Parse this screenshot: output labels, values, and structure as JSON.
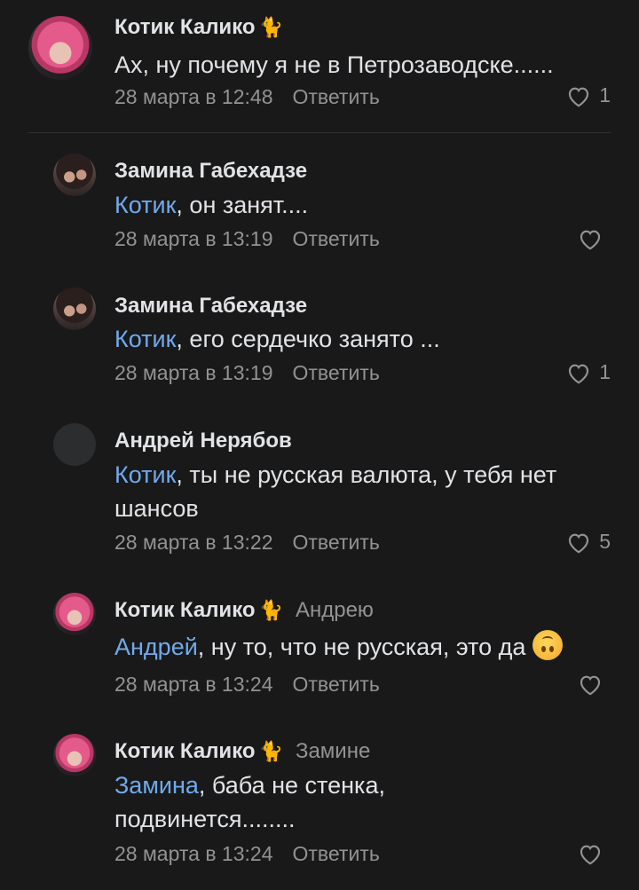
{
  "comments": [
    {
      "author": "Котик Калико",
      "author_emoji": "🐈",
      "reply_to": "",
      "mention": "",
      "text": "Ах, ну почему я не в Петрозаводске......",
      "date": "28 марта в 12:48",
      "reply_label": "Ответить",
      "likes": "1",
      "avatar": "kotik"
    },
    {
      "author": "Замина Габехадзе",
      "author_emoji": "",
      "reply_to": "",
      "mention": "Котик",
      "text": ", он занят....",
      "date": "28 марта в 13:19",
      "reply_label": "Ответить",
      "likes": "",
      "avatar": "zamina"
    },
    {
      "author": "Замина Габехадзе",
      "author_emoji": "",
      "reply_to": "",
      "mention": "Котик",
      "text": ", его сердечко занято ...",
      "date": "28 марта в 13:19",
      "reply_label": "Ответить",
      "likes": "1",
      "avatar": "zamina"
    },
    {
      "author": "Андрей Нерябов",
      "author_emoji": "",
      "reply_to": "",
      "mention": "Котик",
      "text": ", ты не русская валюта, у тебя нет шансов",
      "date": "28 марта в 13:22",
      "reply_label": "Ответить",
      "likes": "5",
      "avatar": "andrey"
    },
    {
      "author": "Котик Калико",
      "author_emoji": "🐈",
      "reply_to": "Андрею",
      "mention": "Андрей",
      "text": ", ну то, что не русская, это да",
      "trailing_emoji": "upside-down-face-icon",
      "date": "28 марта в 13:24",
      "reply_label": "Ответить",
      "likes": "",
      "avatar": "kotik"
    },
    {
      "author": "Котик Калико",
      "author_emoji": "🐈",
      "reply_to": "Замине",
      "mention": "Замина",
      "text": ", баба не стенка, подвинется........",
      "date": "28 марта в 13:24",
      "reply_label": "Ответить",
      "likes": "",
      "avatar": "kotik"
    }
  ],
  "colors": {
    "background": "#19191a",
    "text": "#e1e3e6",
    "secondary": "#939393",
    "mention": "#71aaeb"
  }
}
